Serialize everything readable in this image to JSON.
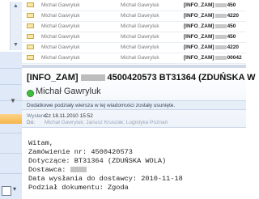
{
  "message_list": {
    "rows": [
      {
        "from": "Michał Gawryluk",
        "to": "Michał Gawryluk",
        "subject_prefix": "[INFO_ZAM]",
        "subject_suffix": "450"
      },
      {
        "from": "Michał Gawryluk",
        "to": "Michał Gawryluk",
        "subject_prefix": "[INFO_ZAM]",
        "subject_suffix": "4220"
      },
      {
        "from": "Michał Gawryluk",
        "to": "Michał Gawryluk",
        "subject_prefix": "[INFO_ZAM]",
        "subject_suffix": "450"
      },
      {
        "from": "Michał Gawryluk",
        "to": "Michał Gawryluk",
        "subject_prefix": "[INFO_ZAM]",
        "subject_suffix": "450"
      },
      {
        "from": "Michał Gawryluk",
        "to": "Michał Gawryluk",
        "subject_prefix": "[INFO_ZAM]",
        "subject_suffix": "4220"
      },
      {
        "from": "Michał Gawryluk",
        "to": "Michał Gawryluk",
        "subject_prefix": "[INFO_ZAM]",
        "subject_suffix": "00042"
      }
    ]
  },
  "reading_pane": {
    "subject_prefix": "[INFO_ZAM]",
    "subject_rest": "4500420573 BT31364 (ZDUŃSKA W",
    "sender": "Michał Gawryluk",
    "info_bar": "Dodatkowe podziały wiersza w tej wiadomości zostały usunięte.",
    "sent_label": "Wysłano:",
    "sent_value": "Cz 18.11.2010 15:52",
    "to_label": "Do:",
    "to_value": "Michał Gawryluk; Janusz Kruszak; Logistyka Poznań",
    "body_lines": {
      "l1": "Witam,",
      "l2": "Zamówienie nr: 4500420573",
      "l3": "Dotyczące: BT31364 (ZDUŃSKA WOLA)",
      "l4": "Dostawca: ",
      "l5": "Data wysłania do dostawcy: 2010-11-18",
      "l6": "Podział dokumentu: Zgoda"
    }
  }
}
